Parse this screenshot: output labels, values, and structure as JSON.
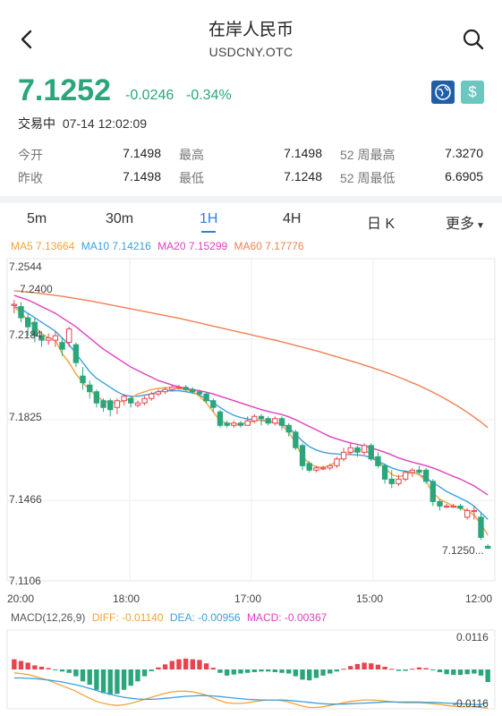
{
  "header": {
    "title": "在岸人民币",
    "subtitle": "USDCNY.OTC"
  },
  "quote": {
    "price": "7.1252",
    "change": "-0.0246",
    "change_pct": "-0.34%",
    "status": "交易中",
    "time": "07-14 12:02:09"
  },
  "stats": [
    [
      {
        "label": "今开",
        "value": "7.1498"
      },
      {
        "label": "最高",
        "value": "7.1498"
      },
      {
        "label": "52 周最高",
        "value": "7.3270"
      }
    ],
    [
      {
        "label": "昨收",
        "value": "7.1498"
      },
      {
        "label": "最低",
        "value": "7.1248"
      },
      {
        "label": "52 周最低",
        "value": "6.6905"
      }
    ]
  ],
  "tabs": [
    {
      "label": "5m"
    },
    {
      "label": "30m"
    },
    {
      "label": "1H",
      "active": true
    },
    {
      "label": "4H"
    },
    {
      "label": "日 K"
    },
    {
      "label": "更多"
    }
  ],
  "ma_legend": [
    {
      "label": "MA5 7.13664",
      "color": "#f2a33a"
    },
    {
      "label": "MA10 7.14216",
      "color": "#3aa0e0"
    },
    {
      "label": "MA20 7.15299",
      "color": "#e040c0"
    },
    {
      "label": "MA60 7.17776",
      "color": "#f08050"
    }
  ],
  "colors": {
    "up": "#e8434e",
    "down": "#2aa57c",
    "ma5": "#f2a33a",
    "ma10": "#3aa0e0",
    "ma20": "#e040c0",
    "ma60": "#f08050"
  },
  "chart_data": {
    "type": "candlestick",
    "ylim": [
      7.1106,
      7.2544
    ],
    "y_ticks": [
      "7.2544",
      "7.2184",
      "7.1825",
      "7.1466",
      "7.1106"
    ],
    "x_ticks": [
      "20:00",
      "18:00",
      "17:00",
      "15:00",
      "12:00"
    ],
    "high_label": "7.2400",
    "last_label": "7.1250...",
    "candles": [
      [
        7.234,
        7.234,
        7.236,
        7.23
      ],
      [
        7.233,
        7.228,
        7.235,
        7.226
      ],
      [
        7.228,
        7.224,
        7.23,
        7.22
      ],
      [
        7.226,
        7.22,
        7.228,
        7.217
      ],
      [
        7.22,
        7.218,
        7.222,
        7.215
      ],
      [
        7.218,
        7.219,
        7.221,
        7.216
      ],
      [
        7.218,
        7.22,
        7.222,
        7.215
      ],
      [
        7.217,
        7.214,
        7.219,
        7.211
      ],
      [
        7.217,
        7.223,
        7.224,
        7.215
      ],
      [
        7.216,
        7.208,
        7.217,
        7.206
      ],
      [
        7.202,
        7.199,
        7.206,
        7.196
      ],
      [
        7.198,
        7.195,
        7.2,
        7.192
      ],
      [
        7.195,
        7.19,
        7.196,
        7.188
      ],
      [
        7.191,
        7.188,
        7.192,
        7.186
      ],
      [
        7.191,
        7.187,
        7.192,
        7.184
      ],
      [
        7.188,
        7.191,
        7.192,
        7.185
      ],
      [
        7.191,
        7.193,
        7.194,
        7.189
      ],
      [
        7.192,
        7.19,
        7.193,
        7.188
      ],
      [
        7.189,
        7.19,
        7.191,
        7.188
      ],
      [
        7.19,
        7.192,
        7.193,
        7.189
      ],
      [
        7.192,
        7.194,
        7.195,
        7.191
      ],
      [
        7.194,
        7.195,
        7.196,
        7.193
      ],
      [
        7.195,
        7.196,
        7.197,
        7.194
      ],
      [
        7.196,
        7.197,
        7.198,
        7.195
      ],
      [
        7.197,
        7.197,
        7.198,
        7.196
      ],
      [
        7.197,
        7.196,
        7.198,
        7.195
      ],
      [
        7.196,
        7.195,
        7.197,
        7.194
      ],
      [
        7.195,
        7.194,
        7.196,
        7.193
      ],
      [
        7.194,
        7.191,
        7.195,
        7.19
      ],
      [
        7.191,
        7.188,
        7.192,
        7.186
      ],
      [
        7.186,
        7.18,
        7.187,
        7.179
      ],
      [
        7.181,
        7.18,
        7.182,
        7.179
      ],
      [
        7.18,
        7.181,
        7.182,
        7.179
      ],
      [
        7.181,
        7.18,
        7.182,
        7.179
      ],
      [
        7.18,
        7.182,
        7.184,
        7.18
      ],
      [
        7.182,
        7.184,
        7.185,
        7.181
      ],
      [
        7.184,
        7.183,
        7.185,
        7.18
      ],
      [
        7.183,
        7.181,
        7.184,
        7.18
      ],
      [
        7.181,
        7.183,
        7.184,
        7.18
      ],
      [
        7.183,
        7.18,
        7.184,
        7.178
      ],
      [
        7.18,
        7.177,
        7.181,
        7.175
      ],
      [
        7.177,
        7.17,
        7.178,
        7.169
      ],
      [
        7.171,
        7.162,
        7.172,
        7.16
      ],
      [
        7.163,
        7.16,
        7.164,
        7.159
      ],
      [
        7.16,
        7.161,
        7.162,
        7.159
      ],
      [
        7.161,
        7.161,
        7.162,
        7.16
      ],
      [
        7.161,
        7.162,
        7.163,
        7.16
      ],
      [
        7.162,
        7.165,
        7.166,
        7.161
      ],
      [
        7.165,
        7.168,
        7.17,
        7.164
      ],
      [
        7.168,
        7.17,
        7.172,
        7.167
      ],
      [
        7.17,
        7.168,
        7.171,
        7.166
      ],
      [
        7.168,
        7.171,
        7.172,
        7.167
      ],
      [
        7.171,
        7.165,
        7.172,
        7.164
      ],
      [
        7.166,
        7.162,
        7.168,
        7.161
      ],
      [
        7.162,
        7.156,
        7.163,
        7.154
      ],
      [
        7.156,
        7.154,
        7.16,
        7.152
      ],
      [
        7.154,
        7.156,
        7.158,
        7.153
      ],
      [
        7.156,
        7.159,
        7.16,
        7.155
      ],
      [
        7.159,
        7.16,
        7.161,
        7.157
      ],
      [
        7.16,
        7.159,
        7.162,
        7.158
      ],
      [
        7.16,
        7.155,
        7.161,
        7.154
      ],
      [
        7.155,
        7.146,
        7.156,
        7.144
      ],
      [
        7.146,
        7.144,
        7.147,
        7.142
      ],
      [
        7.144,
        7.144,
        7.145,
        7.143
      ],
      [
        7.144,
        7.144,
        7.145,
        7.143
      ],
      [
        7.144,
        7.143,
        7.145,
        7.142
      ],
      [
        7.139,
        7.142,
        7.143,
        7.138
      ],
      [
        7.142,
        7.142,
        7.144,
        7.138
      ],
      [
        7.139,
        7.13,
        7.141,
        7.129
      ],
      [
        7.126,
        7.1252,
        7.127,
        7.1248
      ]
    ],
    "ma5": [
      7.233,
      7.23,
      7.227,
      7.224,
      7.221,
      7.219,
      7.218,
      7.212,
      7.208,
      7.203,
      7.199,
      7.196,
      7.193,
      7.191,
      7.19,
      7.19,
      7.191,
      7.192,
      7.194,
      7.195,
      7.196,
      7.1965,
      7.1968,
      7.1968,
      7.1965,
      7.196,
      7.195,
      7.193,
      7.19,
      7.186,
      7.182,
      7.181,
      7.1805,
      7.1805,
      7.181,
      7.182,
      7.1825,
      7.182,
      7.1815,
      7.18,
      7.177,
      7.172,
      7.166,
      7.163,
      7.1615,
      7.1612,
      7.162,
      7.164,
      7.166,
      7.168,
      7.169,
      7.169,
      7.167,
      7.164,
      7.161,
      7.158,
      7.157,
      7.158,
      7.159,
      7.158,
      7.155,
      7.15,
      7.147,
      7.1455,
      7.144,
      7.143,
      7.142,
      7.14,
      7.136,
      7.131
    ],
    "ma10": [
      7.233,
      7.232,
      7.23,
      7.228,
      7.226,
      7.224,
      7.222,
      7.219,
      7.216,
      7.212,
      7.208,
      7.204,
      7.201,
      7.199,
      7.197,
      7.195,
      7.1935,
      7.193,
      7.193,
      7.1935,
      7.194,
      7.195,
      7.1955,
      7.1955,
      7.1955,
      7.195,
      7.1945,
      7.1935,
      7.192,
      7.19,
      7.188,
      7.186,
      7.1845,
      7.1835,
      7.1828,
      7.1825,
      7.1822,
      7.1818,
      7.1812,
      7.1805,
      7.179,
      7.176,
      7.173,
      7.1705,
      7.169,
      7.168,
      7.1675,
      7.1672,
      7.167,
      7.167,
      7.1668,
      7.1665,
      7.1655,
      7.164,
      7.1625,
      7.161,
      7.16,
      7.1595,
      7.159,
      7.158,
      7.1565,
      7.1545,
      7.1525,
      7.1505,
      7.149,
      7.1475,
      7.146,
      7.144,
      7.141,
      7.138
    ],
    "ma20": [
      7.238,
      7.237,
      7.236,
      7.2345,
      7.233,
      7.2315,
      7.23,
      7.228,
      7.226,
      7.224,
      7.2215,
      7.219,
      7.2165,
      7.214,
      7.212,
      7.21,
      7.208,
      7.206,
      7.2045,
      7.203,
      7.2015,
      7.2,
      7.199,
      7.198,
      7.1972,
      7.1965,
      7.196,
      7.1955,
      7.1948,
      7.194,
      7.193,
      7.192,
      7.191,
      7.19,
      7.189,
      7.188,
      7.187,
      7.1862,
      7.1855,
      7.1848,
      7.1838,
      7.1825,
      7.181,
      7.1795,
      7.178,
      7.1765,
      7.175,
      7.174,
      7.173,
      7.1722,
      7.1715,
      7.1708,
      7.17,
      7.169,
      7.168,
      7.1668,
      7.1655,
      7.1645,
      7.1636,
      7.1628,
      7.162,
      7.161,
      7.1598,
      7.1585,
      7.1572,
      7.156,
      7.1545,
      7.153,
      7.151,
      7.149
    ],
    "ma60": [
      7.24,
      7.2398,
      7.2395,
      7.2392,
      7.2388,
      7.2384,
      7.238,
      7.2376,
      7.2371,
      7.2366,
      7.2361,
      7.2356,
      7.235,
      7.2344,
      7.2338,
      7.2332,
      7.2326,
      7.232,
      7.2314,
      7.2308,
      7.2302,
      7.2296,
      7.229,
      7.2284,
      7.2278,
      7.2271,
      7.2264,
      7.2257,
      7.225,
      7.2243,
      7.2236,
      7.2229,
      7.2222,
      7.2215,
      7.2208,
      7.2201,
      7.2194,
      7.2187,
      7.218,
      7.2173,
      7.2165,
      7.2157,
      7.2149,
      7.2141,
      7.2133,
      7.2124,
      7.2115,
      7.2106,
      7.2097,
      7.2088,
      7.2079,
      7.2069,
      7.2059,
      7.2049,
      7.2038,
      7.2027,
      7.2015,
      7.2003,
      7.199,
      7.1977,
      7.1963,
      7.1948,
      7.1932,
      7.1915,
      7.1897,
      7.1878,
      7.1858,
      7.1837,
      7.1815,
      7.179
    ]
  },
  "macd": {
    "label": "MACD(12,26,9)",
    "diff_label": "DIFF: -0.01140",
    "dea_label": "DEA: -0.00956",
    "macd_label": "MACD: -0.00367",
    "y_top": "0.0116",
    "y_bottom": "-0.0116",
    "ylim": [
      -0.0116,
      0.0116
    ],
    "hist": [
      0.003,
      0.0025,
      0.002,
      0.0012,
      0.0008,
      0.0004,
      -0.0002,
      -0.0006,
      -0.001,
      -0.002,
      -0.0035,
      -0.0045,
      -0.006,
      -0.007,
      -0.0075,
      -0.0072,
      -0.006,
      -0.0048,
      -0.0035,
      -0.002,
      -0.0005,
      0.0006,
      0.0015,
      0.0025,
      0.003,
      0.0032,
      0.003,
      0.0028,
      0.0018,
      0.0005,
      -0.001,
      -0.0018,
      -0.0015,
      -0.0012,
      -0.001,
      -0.0008,
      -0.0006,
      -0.0006,
      -0.0008,
      -0.001,
      -0.0012,
      -0.002,
      -0.003,
      -0.0032,
      -0.0025,
      -0.0018,
      -0.0012,
      -0.0006,
      0.0002,
      0.001,
      0.0016,
      0.002,
      0.0018,
      0.0014,
      0.0008,
      0.0002,
      -0.0004,
      -0.0004,
      0.0002,
      0.0006,
      0.0004,
      -0.0002,
      -0.0008,
      -0.0014,
      -0.0016,
      -0.0016,
      -0.0014,
      -0.0012,
      -0.0018,
      -0.0037
    ],
    "diff": [
      -0.001,
      -0.0012,
      -0.0015,
      -0.002,
      -0.0026,
      -0.0032,
      -0.004,
      -0.0048,
      -0.0056,
      -0.0064,
      -0.0075,
      -0.0085,
      -0.0094,
      -0.01,
      -0.0104,
      -0.0106,
      -0.0104,
      -0.01,
      -0.0094,
      -0.0088,
      -0.0082,
      -0.0076,
      -0.007,
      -0.0066,
      -0.0064,
      -0.0064,
      -0.0066,
      -0.007,
      -0.0076,
      -0.0084,
      -0.0092,
      -0.0098,
      -0.01,
      -0.01,
      -0.0098,
      -0.0095,
      -0.0092,
      -0.009,
      -0.009,
      -0.0092,
      -0.0096,
      -0.0102,
      -0.0108,
      -0.0112,
      -0.0112,
      -0.011,
      -0.0106,
      -0.0102,
      -0.0098,
      -0.0094,
      -0.0092,
      -0.009,
      -0.009,
      -0.0091,
      -0.0093,
      -0.0095,
      -0.0097,
      -0.0098,
      -0.0098,
      -0.0098,
      -0.0099,
      -0.0101,
      -0.0103,
      -0.0106,
      -0.0108,
      -0.011,
      -0.011,
      -0.011,
      -0.0112,
      -0.0114
    ],
    "dea": [
      -0.0025,
      -0.0025,
      -0.0026,
      -0.0027,
      -0.0029,
      -0.0031,
      -0.0034,
      -0.0037,
      -0.0041,
      -0.0045,
      -0.005,
      -0.0056,
      -0.0062,
      -0.0068,
      -0.0073,
      -0.0078,
      -0.0082,
      -0.0085,
      -0.0087,
      -0.0088,
      -0.0088,
      -0.0087,
      -0.0085,
      -0.0083,
      -0.0081,
      -0.0079,
      -0.0078,
      -0.0077,
      -0.0077,
      -0.0078,
      -0.008,
      -0.0082,
      -0.0084,
      -0.0086,
      -0.0088,
      -0.0089,
      -0.009,
      -0.009,
      -0.009,
      -0.009,
      -0.0091,
      -0.0093,
      -0.0095,
      -0.0097,
      -0.0099,
      -0.0101,
      -0.0102,
      -0.0102,
      -0.0102,
      -0.0101,
      -0.01,
      -0.0099,
      -0.0098,
      -0.0097,
      -0.0096,
      -0.0096,
      -0.0096,
      -0.0096,
      -0.0096,
      -0.0096,
      -0.0097,
      -0.0097,
      -0.0098,
      -0.0099,
      -0.01,
      -0.0101,
      -0.0102,
      -0.0103,
      -0.0104,
      -0.0096
    ]
  }
}
